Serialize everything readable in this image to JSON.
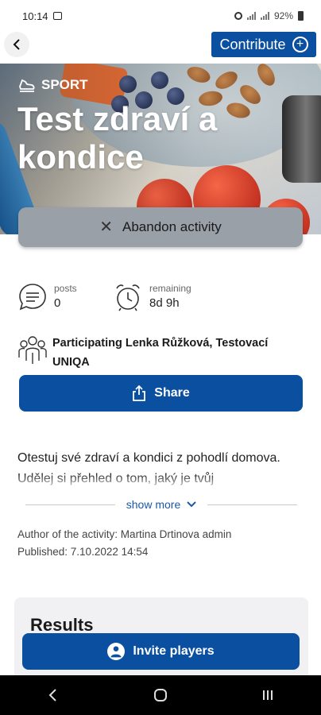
{
  "status_bar": {
    "time": "10:14",
    "battery": "92%"
  },
  "header": {
    "contribute_label": "Contribute"
  },
  "hero": {
    "category": "SPORT",
    "title": "Test zdraví a kondice",
    "abandon_label": "Abandon activity"
  },
  "stats": {
    "posts_label": "posts",
    "posts_value": "0",
    "remaining_label": "remaining",
    "remaining_value": "8d 9h"
  },
  "participants": {
    "text": "Participating Lenka Růžková, Testovací UNIQA"
  },
  "share_label": "Share",
  "description": "Otestuj své zdraví a kondici z pohodlí domova. Udělej si přehled o tom, jaký je tvůj",
  "show_more_label": "show more",
  "meta": {
    "author": "Author of the activity: Martina Drtinova admin",
    "published": "Published: 7.10.2022 14:54"
  },
  "results_title": "Results",
  "invite_label": "Invite players",
  "colors": {
    "primary": "#0a4fa0",
    "abandon_bg": "#9aa0a8",
    "link": "#1a58a6"
  }
}
